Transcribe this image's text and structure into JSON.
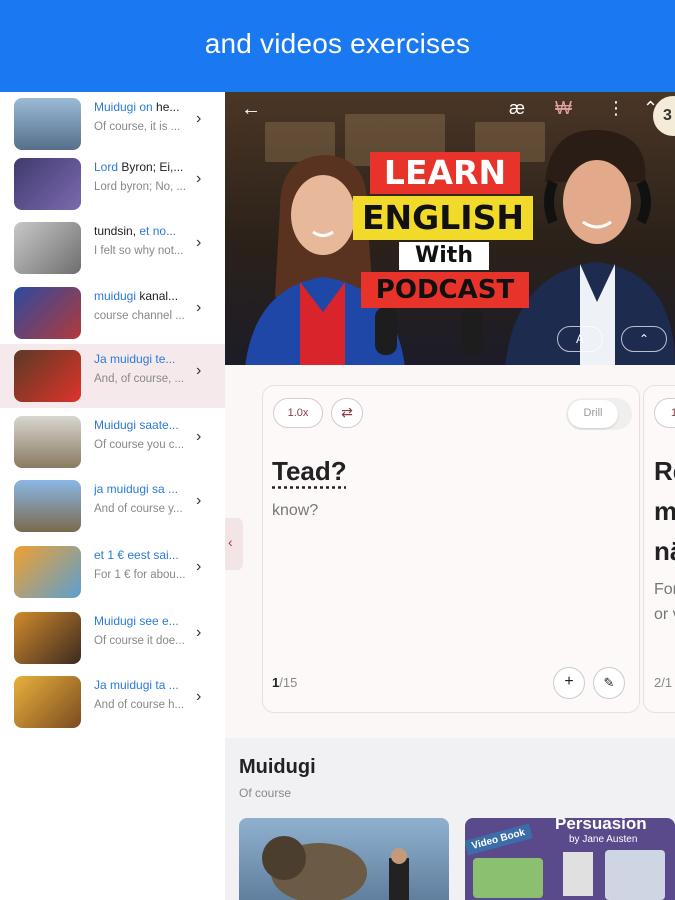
{
  "banner": {
    "title": "and videos exercises"
  },
  "list": {
    "items": [
      {
        "title_hl": "Muidugi on",
        "title_rest": " he...",
        "sub": "Of course, it is ...",
        "thumb": "lion-stage"
      },
      {
        "title_hl": "Lord",
        "title_rest": " Byron; Ei,...",
        "sub": "Lord byron; No, ...",
        "thumb": "persuasion-book"
      },
      {
        "title_plain": "tundsin, ",
        "title_hl": "et no...",
        "sub": "I felt so why not...",
        "thumb": "gray-speaker"
      },
      {
        "title_hl": "muidugi",
        "title_rest": " kanal...",
        "sub": "course channel ...",
        "thumb": "prepositions-time"
      },
      {
        "title_hl": "Ja muidugi te...",
        "title_rest": "",
        "sub": "And, of course, ...",
        "thumb": "learn-english-podcast"
      },
      {
        "title_hl": "Muidugi saate...",
        "title_rest": "",
        "sub": "Of course you c...",
        "thumb": "lecture-hall"
      },
      {
        "title_hl": "ja muidugi sa ...",
        "title_rest": "",
        "sub": "And of course y...",
        "thumb": "outdoor-speaker"
      },
      {
        "title_hl": "et 1 € eest sai...",
        "title_rest": "",
        "sub": "For 1 € for abou...",
        "thumb": "street-scene"
      },
      {
        "title_hl": "Muidugi see e...",
        "title_rest": "",
        "sub": "Of course it doe...",
        "thumb": "great-teacher"
      },
      {
        "title_hl": "Ja muidugi ta ...",
        "title_rest": "",
        "sub": "And of course h...",
        "thumb": "yellow-speaker"
      }
    ]
  },
  "video": {
    "labels": {
      "learn": "LEARN",
      "english": "ENGLISH",
      "with": "With",
      "podcast": "PODCAST"
    },
    "icons": {
      "back": "back-arrow-icon",
      "ae": "æ",
      "won": "₩",
      "more": "⋮",
      "up": "⌃"
    },
    "pill_a": "A",
    "pill_up": "⌃",
    "badge": "3"
  },
  "card": {
    "speed": "1.0x",
    "drill": "Drill",
    "word": "Tead?",
    "translation": "know?",
    "counter_current": "1",
    "counter_total": "/15"
  },
  "card2": {
    "speed": "1",
    "line1": "Re",
    "line2": "m",
    "line3": "nä",
    "sub1": "For",
    "sub2": "or v",
    "counter": "2/1"
  },
  "section": {
    "title": "Muidugi",
    "subtitle": "Of course",
    "tiles": [
      {
        "name": "lion-tile"
      },
      {
        "name": "persuasion-tile",
        "heading": "Persuasion",
        "by": "by Jane Austen",
        "tag": "Video Book"
      }
    ]
  },
  "colors": {
    "banner": "#1a78f0",
    "accent": "#2a7ad8",
    "active_row": "#f5e9eb"
  }
}
